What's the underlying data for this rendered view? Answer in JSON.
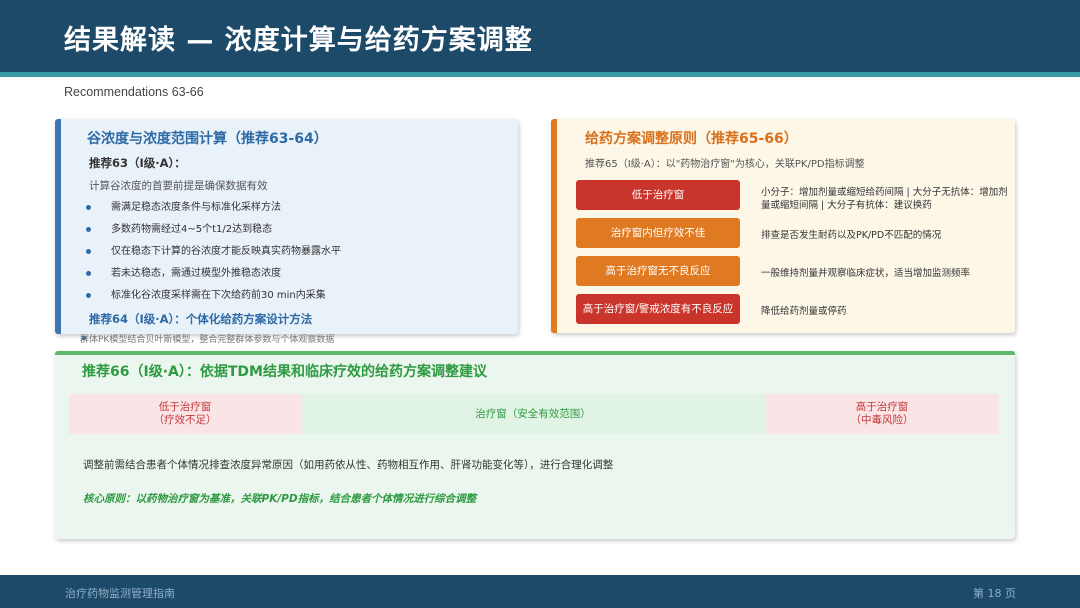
{
  "header": {
    "title": "结果解读 — 浓度计算与给药方案调整",
    "subtitle": "Recommendations 63-66"
  },
  "card1": {
    "title": "谷浓度与浓度范围计算（推荐63-64）",
    "rec63": "推荐63（Ⅰ级·A）：",
    "premise": "计算谷浓度的首要前提是确保数据有效",
    "bullets": [
      "需满足稳态浓度条件与标准化采样方法",
      "多数药物需经过4~5个t1/2达到稳态",
      "仅在稳态下计算的谷浓度才能反映真实药物暴露水平",
      "若未达稳态，需通过模型外推稳态浓度",
      "标准化谷浓度采样需在下次给药前30 min内采集"
    ],
    "rec64": "推荐64（Ⅰ级·A）：个体化给药方案设计方法",
    "overflow_text": "群体PK模型结合贝叶斯模型，整合完整群体参数与个体观察数据"
  },
  "card2": {
    "title": "给药方案调整原则（推荐65-66）",
    "rec65": "推荐65（Ⅰ级·A）：以\"药物治疗窗\"为核心，关联PK/PD指标调整",
    "rows": [
      {
        "label": "低于治疗窗",
        "desc": "小分子：增加剂量或缩短给药间隔 | 大分子无抗体：增加剂量或缩短间隔 | 大分子有抗体：建议换药",
        "color": "#c9342b"
      },
      {
        "label": "治疗窗内但疗效不佳",
        "desc": "排查是否发生耐药以及PK/PD不匹配的情况",
        "color": "#e07a22"
      },
      {
        "label": "高于治疗窗无不良反应",
        "desc": "一般维持剂量并观察临床症状，适当增加监测频率",
        "color": "#e07a22"
      },
      {
        "label": "高于治疗窗/警戒浓度有不良反应",
        "desc": "降低给药剂量或停药",
        "color": "#c9342b"
      }
    ]
  },
  "card3": {
    "title": "推荐66（Ⅰ级·A）：依据TDM结果和临床疗效的给药方案调整建议",
    "ranges": {
      "low_line1": "低于治疗窗",
      "low_line2": "（疗效不足）",
      "mid": "治疗窗（安全有效范围）",
      "high_line1": "高于治疗窗",
      "high_line2": "（中毒风险）"
    },
    "adjust_note": "调整前需结合患者个体情况排查浓度异常原因（如用药依从性、药物相互作用、肝肾功能变化等），进行合理化调整",
    "core_note": "核心原则：以药物治疗窗为基准，关联PK/PD指标，结合患者个体情况进行综合调整"
  },
  "footer": {
    "left": "治疗药物监测管理指南",
    "right": "第 18 页"
  },
  "colors": {
    "header": "#1d4a68",
    "accent_teal": "#3a9aa8",
    "blue": "#2e6aa6",
    "orange": "#e07a22",
    "red": "#c9342b",
    "green": "#2e9a42"
  }
}
